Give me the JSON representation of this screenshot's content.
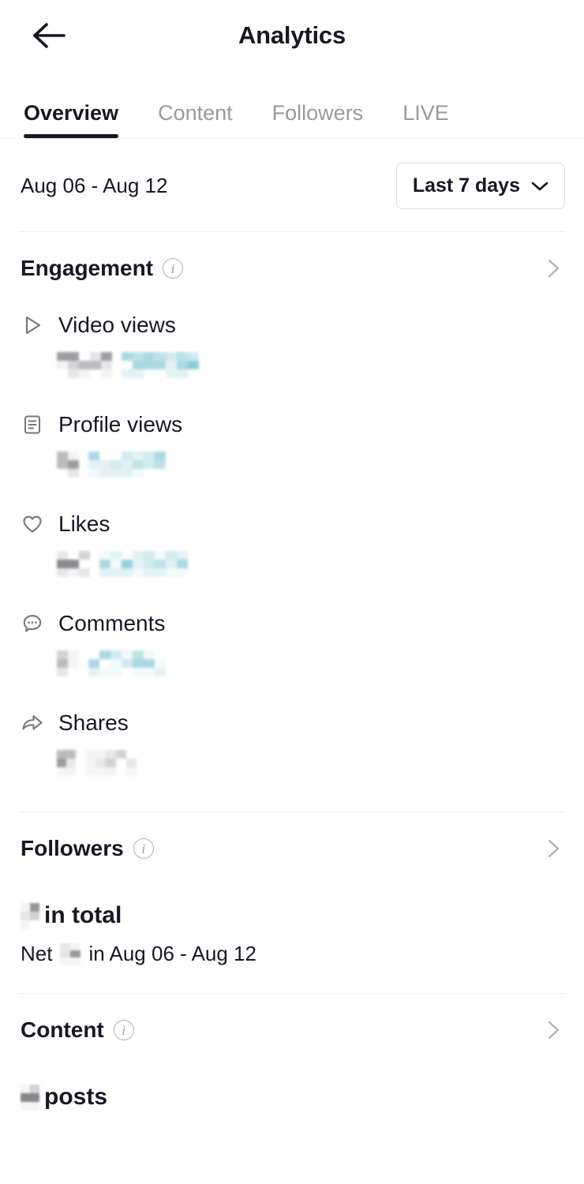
{
  "header": {
    "title": "Analytics",
    "back_icon": "arrow-left-icon"
  },
  "tabs": [
    {
      "label": "Overview",
      "active": true
    },
    {
      "label": "Content",
      "active": false
    },
    {
      "label": "Followers",
      "active": false
    },
    {
      "label": "LIVE",
      "active": false
    }
  ],
  "date_row": {
    "range_text": "Aug 06 - Aug 12",
    "selector_label": "Last 7 days",
    "selector_icon": "chevron-down-icon"
  },
  "engagement": {
    "title": "Engagement",
    "info_icon": "info-icon",
    "chevron_icon": "chevron-right-icon",
    "metrics": [
      {
        "label": "Video views",
        "icon": "play-triangle-icon",
        "value": "redacted",
        "change": "redacted",
        "value_redacted": true,
        "change_redacted": true,
        "change_tone": "blue"
      },
      {
        "label": "Profile views",
        "icon": "document-lines-icon",
        "value": "redacted",
        "change": "redacted",
        "value_redacted": true,
        "change_redacted": true,
        "change_tone": "blue"
      },
      {
        "label": "Likes",
        "icon": "heart-icon",
        "value": "redacted",
        "change": "redacted",
        "value_redacted": true,
        "change_redacted": true,
        "change_tone": "blue"
      },
      {
        "label": "Comments",
        "icon": "comment-bubble-icon",
        "value": "redacted",
        "change": "redacted",
        "value_redacted": true,
        "change_redacted": true,
        "change_tone": "blue"
      },
      {
        "label": "Shares",
        "icon": "share-arrow-icon",
        "value": "redacted",
        "change": "redacted",
        "value_redacted": true,
        "change_redacted": true,
        "change_tone": "gray"
      }
    ]
  },
  "followers": {
    "title": "Followers",
    "info_icon": "info-icon",
    "chevron_icon": "chevron-right-icon",
    "total_suffix": "in total",
    "total_value": "redacted",
    "net_prefix": "Net",
    "net_value": "redacted",
    "net_suffix": "in Aug 06 - Aug 12"
  },
  "content": {
    "title": "Content",
    "info_icon": "info-icon",
    "chevron_icon": "chevron-right-icon",
    "posts_suffix": "posts",
    "posts_value": "redacted"
  },
  "colors": {
    "text_primary": "#161823",
    "text_muted": "#9a9a9e",
    "divider": "#ededee",
    "redaction_gray": "#8a8a8e",
    "redaction_blue": "#a8d8e2"
  }
}
